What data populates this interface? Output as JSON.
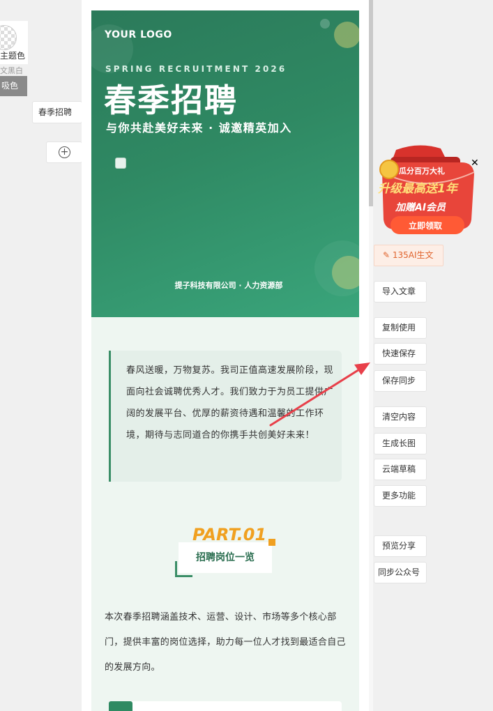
{
  "left_panel": {
    "theme_label": "主题色",
    "bw_label": "文黑白",
    "pick_color": "吸色",
    "template_tag": "春季招聘"
  },
  "hero": {
    "logo": "YOUR LOGO",
    "subtitle_en": "SPRING RECRUITMENT 2026",
    "title": "春季招聘",
    "tagline": "与你共赴美好未来 · 诚邀精英加入",
    "company": "提子科技有限公司 · 人力资源部"
  },
  "quote": {
    "text": "春风送暖，万物复苏。我司正值高速发展阶段，现面向社会诚聘优秀人才。我们致力于为员工提供广阔的发展平台、优厚的薪资待遇和温馨的工作环境，期待与志同道合的你携手共创美好未来！"
  },
  "part": {
    "number": "PART.01",
    "label": "招聘岗位一览"
  },
  "intro": {
    "text": "本次春季招聘涵盖技术、运营、设计、市场等多个核心部门，提供丰富的岗位选择，助力每一位人才找到最适合自己的发展方向。"
  },
  "promo": {
    "line1": "瓜分百万大礼",
    "line2": "升级最高送1年",
    "line3": "加赠AI会员",
    "cta": "立即领取"
  },
  "toolbar": {
    "ai_label": "135AI生文",
    "buttons": [
      "导入文章",
      "复制使用",
      "快速保存",
      "保存同步",
      "清空内容",
      "生成长图",
      "云端草稿",
      "更多功能",
      "预览分享",
      "同步公众号"
    ]
  },
  "colors": {
    "primary_green": "#2f8963",
    "accent_orange": "#f0a020",
    "annotation_red": "#e8404a"
  }
}
